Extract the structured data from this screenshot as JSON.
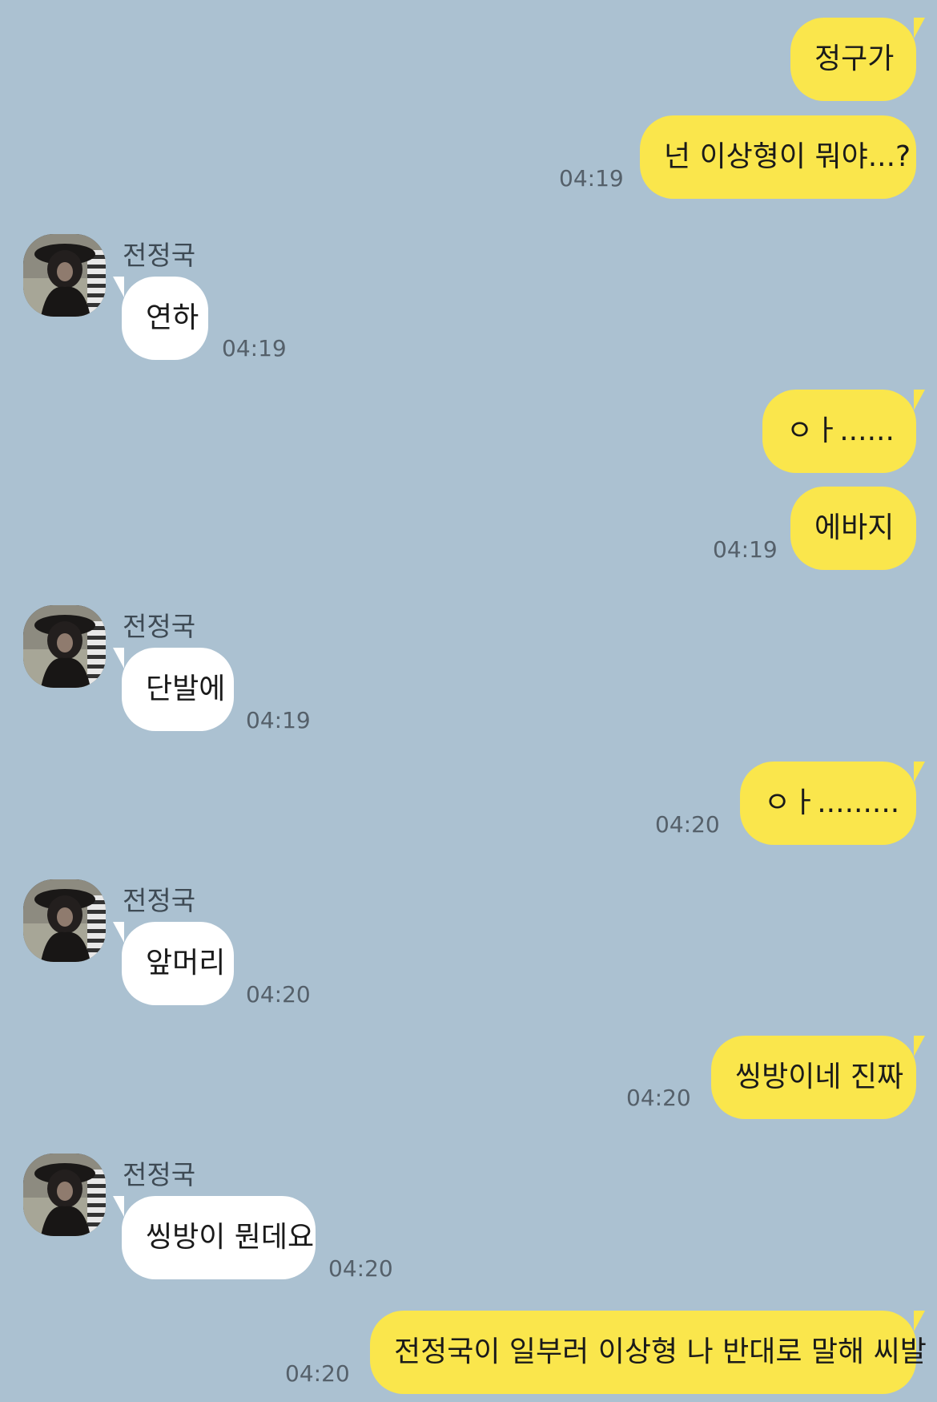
{
  "colors": {
    "background": "#abc1d1",
    "my_bubble": "#fae64c",
    "their_bubble": "#ffffff"
  },
  "messages": [
    {
      "from": "me",
      "text": "정구가"
    },
    {
      "from": "me",
      "text": "넌 이상형이 뭐야...?",
      "time": "04:19"
    },
    {
      "from": "them",
      "sender": "전정국",
      "avatar_icon": "profile-photo",
      "text": "연하",
      "time": "04:19"
    },
    {
      "from": "me",
      "text": "ㅇㅏ......"
    },
    {
      "from": "me",
      "text": "에바지",
      "time": "04:19"
    },
    {
      "from": "them",
      "sender": "전정국",
      "avatar_icon": "profile-photo",
      "text": "단발에",
      "time": "04:19"
    },
    {
      "from": "me",
      "text": "ㅇㅏ.........",
      "time": "04:20"
    },
    {
      "from": "them",
      "sender": "전정국",
      "avatar_icon": "profile-photo",
      "text": "앞머리",
      "time": "04:20"
    },
    {
      "from": "me",
      "text": "씽방이네 진짜",
      "time": "04:20"
    },
    {
      "from": "them",
      "sender": "전정국",
      "avatar_icon": "profile-photo",
      "text": "씽방이 뭔데요",
      "time": "04:20"
    },
    {
      "from": "me",
      "text": "전정국이 일부러 이상형 나 반대로 말해 씨발",
      "time": "04:20"
    }
  ]
}
